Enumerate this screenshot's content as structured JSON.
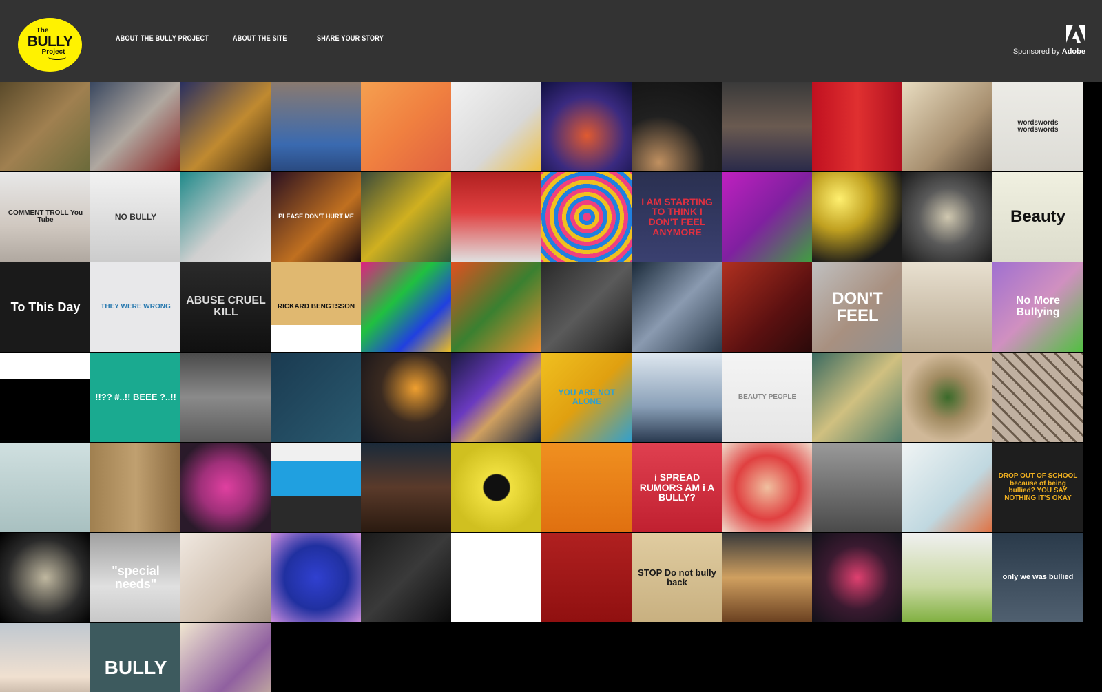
{
  "header": {
    "logo": {
      "the": "The",
      "bully": "BULLY",
      "project": "Project"
    },
    "nav": [
      {
        "label": "ABOUT THE BULLY PROJECT"
      },
      {
        "label": "ABOUT THE SITE"
      },
      {
        "label": "SHARE YOUR STORY"
      }
    ],
    "sponsor": {
      "prefix": "Sponsored by",
      "brand": "Adobe"
    }
  },
  "gallery": {
    "tiles": [
      {
        "text": "",
        "bg": "linear-gradient(135deg,#5a4a2a,#a08050 50%,#6a6a3a)",
        "fg": "#fff"
      },
      {
        "text": "",
        "bg": "linear-gradient(135deg,#3a4860,#b0a8a0 50%,#8a2020)",
        "fg": "#fff"
      },
      {
        "text": "",
        "bg": "linear-gradient(135deg,#2a3060,#c08a30 55%,#3a2810)",
        "fg": "#fff"
      },
      {
        "text": "",
        "bg": "linear-gradient(180deg,#8a7a70,#3a6ab0 70%,#2a4a80)",
        "fg": "#fff"
      },
      {
        "text": "",
        "bg": "linear-gradient(135deg,#f5a050,#f08040 50%,#e06040)",
        "fg": "#fff"
      },
      {
        "text": "",
        "bg": "linear-gradient(135deg,#f2f2f2,#d8d8d8 60%,#f0c040)",
        "fg": "#333"
      },
      {
        "text": "",
        "bg": "radial-gradient(circle at 50% 60%,#e05a30,#3a2a80 55%,#101040)",
        "fg": "#fff"
      },
      {
        "text": "",
        "bg": "radial-gradient(circle at 30% 90%,#c09060,#202020 45%,#111)",
        "fg": "#fff"
      },
      {
        "text": "",
        "bg": "linear-gradient(180deg,#3a3a3a,#6a5a50 50%,#2a2a4a)",
        "fg": "#fff"
      },
      {
        "text": "",
        "bg": "linear-gradient(90deg,#c01020,#e03030 50%,#b01020)",
        "fg": "#fff"
      },
      {
        "text": "",
        "bg": "linear-gradient(135deg,#e8dcc0,#a89070 60%,#504030)",
        "fg": "#fff"
      },
      {
        "text": "wordswords wordswords",
        "bg": "linear-gradient(180deg,#ecebe6,#dddcd6)",
        "fg": "#222",
        "size": 10
      },
      {
        "text": "COMMENT TROLL You Tube",
        "bg": "linear-gradient(180deg,#e8e8e8,#d0c8c0 60%,#b0a8a0)",
        "fg": "#222",
        "size": 10
      },
      {
        "text": "NO BULLY",
        "bg": "linear-gradient(180deg,#f2f2f2,#cccccc)",
        "fg": "#333",
        "size": 12
      },
      {
        "text": "",
        "bg": "linear-gradient(135deg,#208a8a,#d0d0d0 55%,#e0e0e0)",
        "fg": "#fff"
      },
      {
        "text": "PLEASE DON'T HURT ME",
        "bg": "linear-gradient(135deg,#2a1020,#c07020 60%,#1a0a10)",
        "fg": "#fff",
        "size": 9
      },
      {
        "text": "",
        "bg": "linear-gradient(135deg,#3a4a3a,#d0b020 50%,#2a5a3a)",
        "fg": "#fff"
      },
      {
        "text": "",
        "bg": "linear-gradient(180deg,#b02020,#e04040 45%,#e0e0e0)",
        "fg": "#fff"
      },
      {
        "text": "",
        "bg": "repeating-radial-gradient(circle,#f04080 0 6px,#2080e0 6px 12px,#f0c020 12px 18px)",
        "fg": "#fff"
      },
      {
        "text": "I AM STARTING TO THINK I DON'T FEEL ANYMORE",
        "bg": "linear-gradient(180deg,#2a3050,#3a4070)",
        "fg": "#e03040",
        "size": 14
      },
      {
        "text": "",
        "bg": "linear-gradient(135deg,#c020c0,#8020a0 50%,#40a040)",
        "fg": "#fff"
      },
      {
        "text": "",
        "bg": "radial-gradient(circle at 30% 30%,#fff070,#c0a020 35%,#1a1a1a 75%)",
        "fg": "#fff"
      },
      {
        "text": "",
        "bg": "radial-gradient(circle,#d0c8b0,#5a5a5a 45%,#1a1a1a)",
        "fg": "#fff"
      },
      {
        "text": "Beauty",
        "bg": "linear-gradient(180deg,#f0f0e0,#dcdccc)",
        "fg": "#111",
        "size": 24
      },
      {
        "text": "To This Day",
        "bg": "#1a1a1a",
        "fg": "#fff",
        "size": 18
      },
      {
        "text": "THEY WERE WRONG",
        "bg": "#e8e8ea",
        "fg": "#2a7ab0",
        "size": 10
      },
      {
        "text": "ABUSE CRUEL KILL",
        "bg": "linear-gradient(180deg,#2a2a2a,#101010)",
        "fg": "#ddd",
        "size": 16
      },
      {
        "text": "RICKARD BENGTSSON",
        "bg": "linear-gradient(180deg,#e0b870 0 70%,#ffffff 70%)",
        "fg": "#111",
        "size": 10
      },
      {
        "text": "",
        "bg": "linear-gradient(135deg,#e02080,#20c040 40%,#2040e0 70%,#f0c020)",
        "fg": "#fff"
      },
      {
        "text": "",
        "bg": "linear-gradient(135deg,#e05020,#3a8030 50%,#f09030)",
        "fg": "#fff"
      },
      {
        "text": "",
        "bg": "linear-gradient(135deg,#2a2a2a,#5a5a5a 50%,#1a1a1a)",
        "fg": "#fff"
      },
      {
        "text": "",
        "bg": "linear-gradient(135deg,#1a2a3a,#8a9ab0 50%,#2a3a4a)",
        "fg": "#fff"
      },
      {
        "text": "",
        "bg": "linear-gradient(135deg,#b03020,#5a1010 60%,#2a0a0a)",
        "fg": "#fff"
      },
      {
        "text": "DON'T FEEL",
        "bg": "linear-gradient(135deg,#c0c0c0,#a89080 55%,#909090)",
        "fg": "#fff",
        "size": 24
      },
      {
        "text": "",
        "bg": "linear-gradient(180deg,#e8e0d0,#b8a890)",
        "fg": "#fff"
      },
      {
        "text": "No More Bullying",
        "bg": "linear-gradient(135deg,#a070d0,#d090c0 50%,#50c040)",
        "fg": "#fff",
        "size": 16
      },
      {
        "text": "",
        "bg": "linear-gradient(180deg,#ffffff 0 30%,#000000 30%)",
        "fg": "#fff"
      },
      {
        "text": "!!?? #..!! BEEE ?..!!",
        "bg": "#1aaa90",
        "fg": "#fff",
        "size": 13
      },
      {
        "text": "",
        "bg": "linear-gradient(180deg,#4a4a4a,#8a8a8a 50%,#5a5a5a)",
        "fg": "#fff"
      },
      {
        "text": "",
        "bg": "linear-gradient(135deg,#1a3a50,#2a5a70)",
        "fg": "#fff"
      },
      {
        "text": "",
        "bg": "radial-gradient(circle at 60% 40%,#f0a030,#3a2a20 45%,#101018)",
        "fg": "#fff"
      },
      {
        "text": "",
        "bg": "linear-gradient(135deg,#1a1a40,#6a3ac0 40%,#d0a060 60%,#102040)",
        "fg": "#fff"
      },
      {
        "text": "YOU ARE NOT ALONE",
        "bg": "linear-gradient(135deg,#f0c020,#e0a010 50%,#30a0d0)",
        "fg": "#30a0d0",
        "size": 12
      },
      {
        "text": "",
        "bg": "linear-gradient(180deg,#dfe8f0,#8aa0b8 60%,#2a3a50)",
        "fg": "#fff"
      },
      {
        "text": "BEAUTY PEOPLE",
        "bg": "linear-gradient(180deg,#f4f4f4,#e6e6e6)",
        "fg": "#888",
        "size": 10
      },
      {
        "text": "",
        "bg": "linear-gradient(135deg,#3a6a60,#d0c080 50%,#4a7a6a)",
        "fg": "#fff"
      },
      {
        "text": "",
        "bg": "radial-gradient(circle,#3a6a2a,#a08a60 35%,#d0b898 70%)",
        "fg": "#fff"
      },
      {
        "text": "",
        "bg": "repeating-linear-gradient(45deg,#6a5a4a 0 3px,#c0b0a0 3px 14px)",
        "fg": "#fff"
      },
      {
        "text": "",
        "bg": "linear-gradient(180deg,#d0e0e0,#a8c0c0)",
        "fg": "#333"
      },
      {
        "text": "",
        "bg": "linear-gradient(90deg,#a08050,#c0a070 50%,#8a6a40)",
        "fg": "#fff"
      },
      {
        "text": "",
        "bg": "radial-gradient(circle,#e040a0,#a0307a 40%,#2a1a2a 80%)",
        "fg": "#fff"
      },
      {
        "text": "",
        "bg": "linear-gradient(180deg,#f0f0f0 0 20%,#20a0e0 20% 60%,#2a2a2a 60%)",
        "fg": "#fff"
      },
      {
        "text": "",
        "bg": "linear-gradient(180deg,#1a2a3a,#5a3a2a 50%,#2a1a10)",
        "fg": "#fff"
      },
      {
        "text": "",
        "bg": "radial-gradient(circle,#101010 20%,#f0e040 22%,#d0c020 70%)",
        "fg": "#fff"
      },
      {
        "text": "",
        "bg": "linear-gradient(180deg,#f09020,#e07010)",
        "fg": "#fff"
      },
      {
        "text": "i SPREAD RUMORS AM i A BULLY?",
        "bg": "linear-gradient(180deg,#e04050,#c02030)",
        "fg": "#fff",
        "size": 14
      },
      {
        "text": "",
        "bg": "radial-gradient(circle,#f0c0a0,#e04040 50%,#f0e0d0)",
        "fg": "#fff"
      },
      {
        "text": "",
        "bg": "linear-gradient(180deg,#9a9a9a,#4a4a4a)",
        "fg": "#fff"
      },
      {
        "text": "",
        "bg": "linear-gradient(135deg,#f0f4f4,#c0d8e0 60%,#e07040)",
        "fg": "#fff"
      },
      {
        "text": "DROP OUT OF SCHOOL because of being bullied? YOU SAY NOTHING IT'S OKAY",
        "bg": "#1e1e1e",
        "fg": "#f0b020",
        "size": 10
      },
      {
        "text": "",
        "bg": "radial-gradient(circle,#c0b8a0,#2a2a2a 60%,#000)",
        "fg": "#fff"
      },
      {
        "text": "\"special needs\"",
        "bg": "linear-gradient(180deg,#a0a0a0,#e0e0e0 60%,#c8c8c8)",
        "fg": "#fff",
        "size": 18
      },
      {
        "text": "",
        "bg": "linear-gradient(135deg,#f0e8e0,#d0c0b0 60%,#a09080)",
        "fg": "#fff"
      },
      {
        "text": "",
        "bg": "radial-gradient(circle,#3040d0,#2030a0 50%,#d090e0)",
        "fg": "#fff"
      },
      {
        "text": "",
        "bg": "linear-gradient(135deg,#1a1a1a,#3a3a3a 50%,#0a0a0a)",
        "fg": "#fff"
      },
      {
        "text": "",
        "bg": "#ffffff",
        "fg": "#111"
      },
      {
        "text": "",
        "bg": "linear-gradient(180deg,#b02020,#901010)",
        "fg": "#fff"
      },
      {
        "text": "STOP Do not bully back",
        "bg": "linear-gradient(180deg,#e0cca0,#c8b080)",
        "fg": "#1a1a1a",
        "size": 13
      },
      {
        "text": "",
        "bg": "linear-gradient(180deg,#3a3a3a,#d0a060 50%,#6a4020)",
        "fg": "#fff"
      },
      {
        "text": "",
        "bg": "radial-gradient(circle,#e04070,#3a1a30 50%,#101018)",
        "fg": "#fff"
      },
      {
        "text": "",
        "bg": "linear-gradient(180deg,#f0f0f0,#c8d8a0 60%,#80b040)",
        "fg": "#fff"
      },
      {
        "text": "only we was bullied",
        "bg": "linear-gradient(180deg,#2a3a4a,#506070)",
        "fg": "#fff",
        "size": 11
      },
      {
        "text": "",
        "bg": "linear-gradient(180deg,#c0c8d0,#f0e0d0 60%,#a09080)",
        "fg": "#fff"
      },
      {
        "text": "BULLY",
        "bg": "#3d5a5e",
        "fg": "#fff",
        "size": 28
      },
      {
        "text": "",
        "bg": "linear-gradient(135deg,#f0e6d0,#9060a0 60%,#d0c0a0)",
        "fg": "#fff"
      }
    ]
  }
}
